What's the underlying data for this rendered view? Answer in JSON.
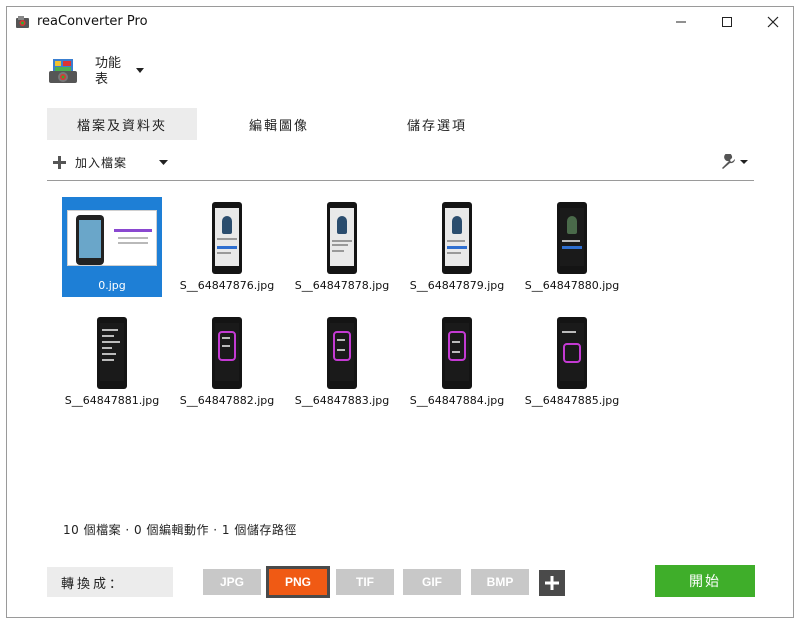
{
  "window": {
    "title": "reaConverter Pro"
  },
  "menu": {
    "label": "功能表"
  },
  "tabs": [
    {
      "label": "檔案及資料夾"
    },
    {
      "label": "編輯圖像"
    },
    {
      "label": "儲存選項"
    }
  ],
  "toolbar": {
    "add_files_label": "加入檔案"
  },
  "files": [
    {
      "name": "0.jpg"
    },
    {
      "name": "S__64847876.jpg"
    },
    {
      "name": "S__64847878.jpg"
    },
    {
      "name": "S__64847879.jpg"
    },
    {
      "name": "S__64847880.jpg"
    },
    {
      "name": "S__64847881.jpg"
    },
    {
      "name": "S__64847882.jpg"
    },
    {
      "name": "S__64847883.jpg"
    },
    {
      "name": "S__64847884.jpg"
    },
    {
      "name": "S__64847885.jpg"
    }
  ],
  "status": {
    "text": "10 個檔案 · 0 個編輯動作 · 1 個儲存路徑"
  },
  "convert": {
    "label": "轉換成：",
    "formats": [
      "JPG",
      "PNG",
      "TIF",
      "GIF",
      "BMP"
    ],
    "selected": "PNG",
    "start_label": "開始"
  },
  "colors": {
    "selected_file": "#1e7fd6",
    "active_format": "#f05a14",
    "start_button": "#3fae2a"
  }
}
